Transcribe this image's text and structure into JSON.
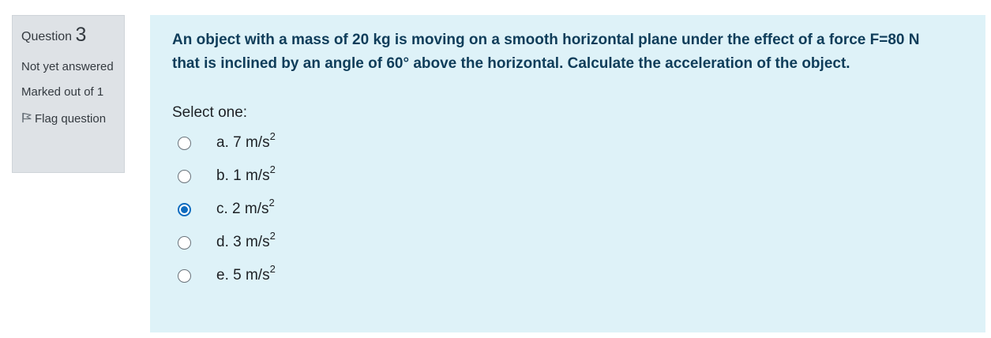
{
  "info": {
    "question_label": "Question",
    "question_number": "3",
    "state": "Not yet answered",
    "grade": "Marked out of 1",
    "flag_label": "Flag question"
  },
  "question": {
    "text": "An object with a mass of 20 kg is moving on a smooth horizontal plane under the effect of a force F=80 N that is inclined by an angle of 60° above the horizontal. Calculate the acceleration of the object.",
    "prompt": "Select one:",
    "selected_index": 2,
    "answers": [
      {
        "label": "a. 7 m/s",
        "exponent": "2"
      },
      {
        "label": "b. 1 m/s",
        "exponent": "2"
      },
      {
        "label": "c. 2 m/s",
        "exponent": "2"
      },
      {
        "label": "d. 3 m/s",
        "exponent": "2"
      },
      {
        "label": "e. 5 m/s",
        "exponent": "2"
      }
    ]
  },
  "colors": {
    "info_bg": "#dee2e6",
    "content_bg": "#def2f8",
    "question_text": "#0f3d5a",
    "radio_selected": "#0f6cbf"
  },
  "icons": {
    "flag": "flag-icon"
  }
}
